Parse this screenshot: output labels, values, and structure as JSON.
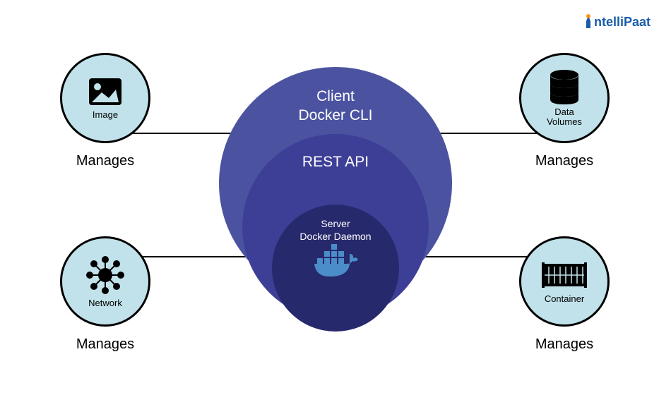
{
  "logo": {
    "brand": "ntelliPaat"
  },
  "center": {
    "outer": {
      "line1": "Client",
      "line2": "Docker CLI"
    },
    "middle": {
      "label": "REST API"
    },
    "inner": {
      "line1": "Server",
      "line2": "Docker Daemon"
    }
  },
  "nodes": {
    "image": {
      "label": "Image",
      "relation": "Manages"
    },
    "data_volumes": {
      "label": "Data\nVolumes",
      "relation": "Manages"
    },
    "network": {
      "label": "Network",
      "relation": "Manages"
    },
    "container": {
      "label": "Container",
      "relation": "Manages"
    }
  }
}
